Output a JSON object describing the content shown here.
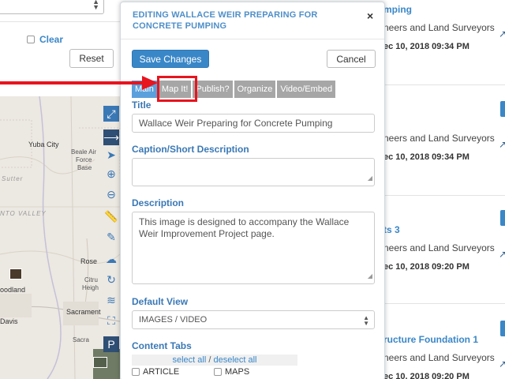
{
  "filter_panel": {
    "clear_label": "Clear",
    "reset_label": "Reset"
  },
  "map": {
    "labels": {
      "yuba_city": "Yuba City",
      "beale_1": "Beale Air",
      "beale_2": "Force",
      "beale_3": "Base",
      "sutter": "Sutter",
      "valley": "NTO VALLEY",
      "roseville": "Rose",
      "citrus_1": "Citru",
      "citrus_2": "Heigh",
      "woodland": "oodland",
      "sacramento": "Sacrament",
      "davis": "Davis",
      "sacra": "Sacra"
    }
  },
  "modal": {
    "title": "EDITING WALLACE WEIR PREPARING FOR CONCRETE PUMPING",
    "close_icon": "×",
    "save_label": "Save Changes",
    "cancel_label": "Cancel",
    "tabs": [
      {
        "label": "Main"
      },
      {
        "label": "Map It!"
      },
      {
        "label": "Publish?"
      },
      {
        "label": "Organize"
      },
      {
        "label": "Video/Embed"
      }
    ],
    "title_label": "Title",
    "title_value": "Wallace Weir Preparing for Concrete Pumping",
    "caption_label": "Caption/Short Description",
    "caption_value": "",
    "description_label": "Description",
    "description_value": "This image is designed to accompany the Wallace Weir Improvement Project page.",
    "default_view_label": "Default View",
    "default_view_value": "IMAGES / VIDEO",
    "content_tabs_label": "Content Tabs",
    "select_all": "select all",
    "deselect_all": "deselect all",
    "checkbox_article": "ARTICLE",
    "checkbox_maps": "MAPS"
  },
  "list": {
    "items": [
      {
        "title": "mping",
        "subtitle": "neers and Land Surveyors",
        "date": "ec 10, 2018 09:34 PM"
      },
      {
        "title": "",
        "subtitle": "neers and Land Surveyors",
        "date": "ec 10, 2018 09:34 PM"
      },
      {
        "title": "ts 3",
        "subtitle": "neers and Land Surveyors",
        "date": "ec 10, 2018 09:20 PM"
      },
      {
        "title": "ructure Foundation 1",
        "subtitle": "neers and Land Surveyors",
        "date": "ec 10, 2018 09:20 PM"
      }
    ]
  },
  "colors": {
    "accent": "#3a87c8",
    "annotation": "#e8141e",
    "tab_inactive": "#a6a6a6",
    "tab_active": "#5aa0dc"
  }
}
